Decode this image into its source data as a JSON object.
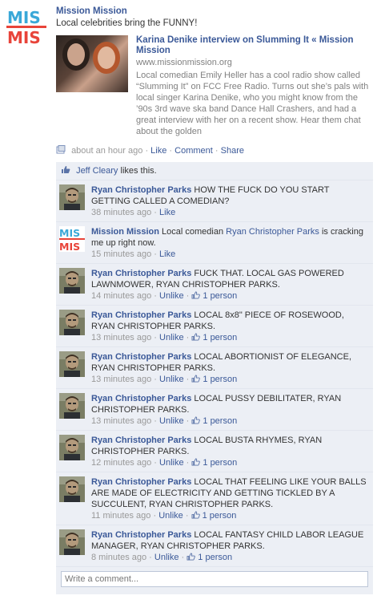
{
  "page": {
    "name": "Mission Mission",
    "message": "Local celebrities bring the FUNNY!",
    "logo_text": "MIS MIS"
  },
  "attachment": {
    "title": "Karina Denike interview on Slumming It « Mission Mission",
    "url": "www.missionmission.org",
    "description": "Local comedian Emily Heller has a cool radio show called “Slumming It” on FCC Free Radio. Turns out she’s pals with local singer Karina Denike, who you might know from the ’90s 3rd wave ska band Dance Hall Crashers, and had a great interview with her on a recent show. Hear them chat about the golden"
  },
  "post_meta": {
    "time": "about an hour ago",
    "sep": "·",
    "like": "Like",
    "comment": "Comment",
    "share": "Share"
  },
  "likes": {
    "name": "Jeff Cleary",
    "suffix": "likes this."
  },
  "comments": [
    {
      "author": "Ryan Christopher Parks",
      "text": "HOW THE FUCK DO YOU START GETTING CALLED A COMEDIAN?",
      "time": "38 minutes ago",
      "action": "Like",
      "count": ""
    },
    {
      "author": "Mission Mission",
      "pre": "Local comedian ",
      "mention": "Ryan Christopher Parks",
      "post": " is cracking me up right now.",
      "time": "15 minutes ago",
      "action": "Like",
      "count": ""
    },
    {
      "author": "Ryan Christopher Parks",
      "text": "FUCK THAT. LOCAL GAS POWERED LAWNMOWER, RYAN CHRISTOPHER PARKS.",
      "time": "14 minutes ago",
      "action": "Unlike",
      "count": "1 person"
    },
    {
      "author": "Ryan Christopher Parks",
      "text": "LOCAL 8x8\" PIECE OF ROSEWOOD, RYAN CHRISTOPHER PARKS.",
      "time": "13 minutes ago",
      "action": "Unlike",
      "count": "1 person"
    },
    {
      "author": "Ryan Christopher Parks",
      "text": "LOCAL ABORTIONIST OF ELEGANCE, RYAN CHRISTOPHER PARKS.",
      "time": "13 minutes ago",
      "action": "Unlike",
      "count": "1 person"
    },
    {
      "author": "Ryan Christopher Parks",
      "text": "LOCAL PUSSY DEBILITATER, RYAN CHRISTOPHER PARKS.",
      "time": "13 minutes ago",
      "action": "Unlike",
      "count": "1 person"
    },
    {
      "author": "Ryan Christopher Parks",
      "text": "LOCAL BUSTA RHYMES, RYAN CHRISTOPHER PARKS.",
      "time": "12 minutes ago",
      "action": "Unlike",
      "count": "1 person"
    },
    {
      "author": "Ryan Christopher Parks",
      "text": "LOCAL THAT FEELING LIKE YOUR BALLS ARE MADE OF ELECTRICITY AND GETTING TICKLED BY A SUCCULENT, RYAN CHRISTOPHER PARKS.",
      "time": "11 minutes ago",
      "action": "Unlike",
      "count": "1 person"
    },
    {
      "author": "Ryan Christopher Parks",
      "text": "LOCAL FANTASY CHILD LABOR LEAGUE MANAGER, RYAN CHRISTOPHER PARKS.",
      "time": "8 minutes ago",
      "action": "Unlike",
      "count": "1 person"
    }
  ],
  "write_comment": {
    "placeholder": "Write a comment..."
  },
  "colors": {
    "link": "#3b5998",
    "ufi_bg": "#eceff5",
    "logo_blue": "#3aa8d8",
    "logo_red": "#e8443a"
  }
}
